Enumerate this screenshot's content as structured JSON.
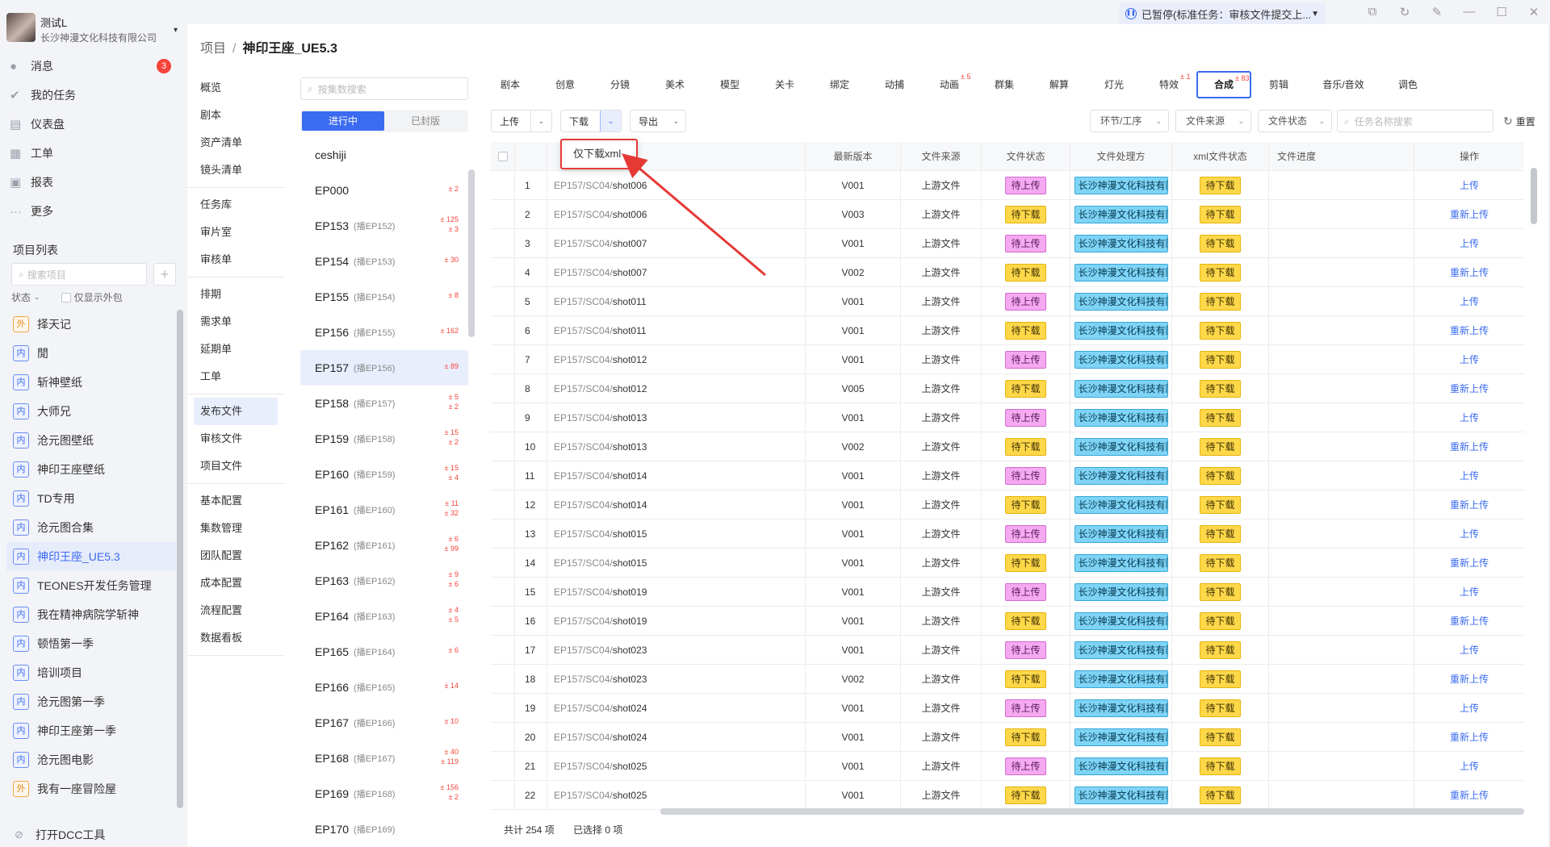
{
  "user": {
    "name": "测试L",
    "company": "长沙神漫文化科技有限公司"
  },
  "nav": [
    {
      "label": "消息",
      "icon": "bell-icon",
      "badge": "3"
    },
    {
      "label": "我的任务",
      "icon": "check-icon"
    },
    {
      "label": "仪表盘",
      "icon": "dashboard-icon"
    },
    {
      "label": "工单",
      "icon": "ticket-icon"
    },
    {
      "label": "报表",
      "icon": "report-icon"
    },
    {
      "label": "更多",
      "icon": "more-icon"
    }
  ],
  "projects": {
    "title": "项目列表",
    "search_placeholder": "搜索项目",
    "status_label": "状态",
    "only_external_label": "仅显示外包",
    "items": [
      {
        "tag": "外",
        "name": "择天记"
      },
      {
        "tag": "内",
        "name": "閒"
      },
      {
        "tag": "内",
        "name": "斩神壁纸"
      },
      {
        "tag": "内",
        "name": "大师兄"
      },
      {
        "tag": "内",
        "name": "沧元图壁纸"
      },
      {
        "tag": "内",
        "name": "神印王座壁纸"
      },
      {
        "tag": "内",
        "name": "TD专用"
      },
      {
        "tag": "内",
        "name": "沧元图合集"
      },
      {
        "tag": "内",
        "name": "神印王座_UE5.3"
      },
      {
        "tag": "内",
        "name": "TEONES开发任务管理"
      },
      {
        "tag": "内",
        "name": "我在精神病院学斩神"
      },
      {
        "tag": "内",
        "name": "顿悟第一季"
      },
      {
        "tag": "内",
        "name": "培训项目"
      },
      {
        "tag": "内",
        "name": "沧元图第一季"
      },
      {
        "tag": "内",
        "name": "神印王座第一季"
      },
      {
        "tag": "内",
        "name": "沧元图电影"
      },
      {
        "tag": "外",
        "name": "我有一座冒险屋"
      }
    ]
  },
  "dcc_label": "打开DCC工具",
  "status_bar": {
    "text": "已暂停(标准任务：审核文件提交上..."
  },
  "breadcrumb": {
    "root": "项目",
    "sep": "/",
    "current": "神印王座_UE5.3"
  },
  "subnav": [
    [
      "概览",
      "剧本",
      "资产清单",
      "镜头清单"
    ],
    [
      "任务库",
      "审片室",
      "审核单"
    ],
    [
      "排期",
      "需求单",
      "延期单",
      "工单"
    ],
    [
      "发布文件",
      "审核文件",
      "项目文件"
    ],
    [
      "基本配置",
      "集数管理",
      "团队配置",
      "成本配置",
      "流程配置",
      "数据看板"
    ]
  ],
  "episodes": {
    "search_placeholder": "按集数搜索",
    "tab_active": "进行中",
    "tab_sealed": "已封版",
    "items": [
      {
        "name": "ceshiji",
        "sub": "",
        "s1": "",
        "s2": ""
      },
      {
        "name": "EP000",
        "sub": "",
        "s1": "± 2",
        "s2": ""
      },
      {
        "name": "EP153",
        "sub": "(播EP152)",
        "s1": "± 125",
        "s2": "± 3"
      },
      {
        "name": "EP154",
        "sub": "(播EP153)",
        "s1": "± 30",
        "s2": ""
      },
      {
        "name": "EP155",
        "sub": "(播EP154)",
        "s1": "± 8",
        "s2": ""
      },
      {
        "name": "EP156",
        "sub": "(播EP155)",
        "s1": "± 162",
        "s2": ""
      },
      {
        "name": "EP157",
        "sub": "(播EP156)",
        "s1": "± 89",
        "s2": ""
      },
      {
        "name": "EP158",
        "sub": "(播EP157)",
        "s1": "± 5",
        "s2": "± 2"
      },
      {
        "name": "EP159",
        "sub": "(播EP158)",
        "s1": "± 15",
        "s2": "± 2"
      },
      {
        "name": "EP160",
        "sub": "(播EP159)",
        "s1": "± 15",
        "s2": "± 4"
      },
      {
        "name": "EP161",
        "sub": "(播EP160)",
        "s1": "± 11",
        "s2": "± 32"
      },
      {
        "name": "EP162",
        "sub": "(播EP161)",
        "s1": "± 6",
        "s2": "± 99"
      },
      {
        "name": "EP163",
        "sub": "(播EP162)",
        "s1": "± 9",
        "s2": "± 6"
      },
      {
        "name": "EP164",
        "sub": "(播EP163)",
        "s1": "± 4",
        "s2": "± 5"
      },
      {
        "name": "EP165",
        "sub": "(播EP164)",
        "s1": "± 6",
        "s2": ""
      },
      {
        "name": "EP166",
        "sub": "(播EP165)",
        "s1": "± 14",
        "s2": ""
      },
      {
        "name": "EP167",
        "sub": "(播EP166)",
        "s1": "± 10",
        "s2": ""
      },
      {
        "name": "EP168",
        "sub": "(播EP167)",
        "s1": "± 40",
        "s2": "± 119"
      },
      {
        "name": "EP169",
        "sub": "(播EP168)",
        "s1": "± 156",
        "s2": "± 2"
      },
      {
        "name": "EP170",
        "sub": "(播EP169)",
        "s1": "",
        "s2": ""
      }
    ]
  },
  "tabs": [
    {
      "label": "剧本",
      "badge": ""
    },
    {
      "label": "创意",
      "badge": ""
    },
    {
      "label": "分镜",
      "badge": ""
    },
    {
      "label": "美术",
      "badge": ""
    },
    {
      "label": "模型",
      "badge": ""
    },
    {
      "label": "关卡",
      "badge": ""
    },
    {
      "label": "绑定",
      "badge": ""
    },
    {
      "label": "动捕",
      "badge": ""
    },
    {
      "label": "动画",
      "badge": "± 5"
    },
    {
      "label": "群集",
      "badge": ""
    },
    {
      "label": "解算",
      "badge": ""
    },
    {
      "label": "灯光",
      "badge": ""
    },
    {
      "label": "特效",
      "badge": "± 1"
    },
    {
      "label": "合成",
      "badge": "± 83"
    },
    {
      "label": "剪辑",
      "badge": ""
    },
    {
      "label": "音乐/音效",
      "badge": ""
    },
    {
      "label": "调色",
      "badge": ""
    }
  ],
  "toolbar": {
    "upload": "上传",
    "download": "下载",
    "export": "导出",
    "filter_stage": "环节/工序",
    "filter_source": "文件来源",
    "filter_status": "文件状态",
    "task_search_placeholder": "任务名称搜索",
    "reset": "重置"
  },
  "dropdown": {
    "item": "仅下载xml"
  },
  "table": {
    "headers": [
      "",
      "",
      "",
      "最新版本",
      "文件来源",
      "文件状态",
      "文件处理方",
      "xml文件状态",
      "文件进度",
      "操作"
    ],
    "shot_prefix": "EP157/SC04/",
    "rows": [
      {
        "n": "1",
        "shot": "shot006",
        "ver": "V001",
        "src": "上游文件",
        "st": "待上传",
        "co": "长沙神漫文化科技有限公司",
        "xml": "待下载",
        "op": "上传"
      },
      {
        "n": "2",
        "shot": "shot006",
        "ver": "V003",
        "src": "上游文件",
        "st": "待下载",
        "co": "长沙神漫文化科技有限公司",
        "xml": "待下载",
        "op": "重新上传"
      },
      {
        "n": "3",
        "shot": "shot007",
        "ver": "V001",
        "src": "上游文件",
        "st": "待上传",
        "co": "长沙神漫文化科技有限公司",
        "xml": "待下载",
        "op": "上传"
      },
      {
        "n": "4",
        "shot": "shot007",
        "ver": "V002",
        "src": "上游文件",
        "st": "待下载",
        "co": "长沙神漫文化科技有限公司",
        "xml": "待下载",
        "op": "重新上传"
      },
      {
        "n": "5",
        "shot": "shot011",
        "ver": "V001",
        "src": "上游文件",
        "st": "待上传",
        "co": "长沙神漫文化科技有限公司",
        "xml": "待下载",
        "op": "上传"
      },
      {
        "n": "6",
        "shot": "shot011",
        "ver": "V001",
        "src": "上游文件",
        "st": "待下载",
        "co": "长沙神漫文化科技有限公司",
        "xml": "待下载",
        "op": "重新上传"
      },
      {
        "n": "7",
        "shot": "shot012",
        "ver": "V001",
        "src": "上游文件",
        "st": "待上传",
        "co": "长沙神漫文化科技有限公司",
        "xml": "待下载",
        "op": "上传"
      },
      {
        "n": "8",
        "shot": "shot012",
        "ver": "V005",
        "src": "上游文件",
        "st": "待下载",
        "co": "长沙神漫文化科技有限公司",
        "xml": "待下载",
        "op": "重新上传"
      },
      {
        "n": "9",
        "shot": "shot013",
        "ver": "V001",
        "src": "上游文件",
        "st": "待上传",
        "co": "长沙神漫文化科技有限公司",
        "xml": "待下载",
        "op": "上传"
      },
      {
        "n": "10",
        "shot": "shot013",
        "ver": "V002",
        "src": "上游文件",
        "st": "待下载",
        "co": "长沙神漫文化科技有限公司",
        "xml": "待下载",
        "op": "重新上传"
      },
      {
        "n": "11",
        "shot": "shot014",
        "ver": "V001",
        "src": "上游文件",
        "st": "待上传",
        "co": "长沙神漫文化科技有限公司",
        "xml": "待下载",
        "op": "上传"
      },
      {
        "n": "12",
        "shot": "shot014",
        "ver": "V001",
        "src": "上游文件",
        "st": "待下载",
        "co": "长沙神漫文化科技有限公司",
        "xml": "待下载",
        "op": "重新上传"
      },
      {
        "n": "13",
        "shot": "shot015",
        "ver": "V001",
        "src": "上游文件",
        "st": "待上传",
        "co": "长沙神漫文化科技有限公司",
        "xml": "待下载",
        "op": "上传"
      },
      {
        "n": "14",
        "shot": "shot015",
        "ver": "V001",
        "src": "上游文件",
        "st": "待下载",
        "co": "长沙神漫文化科技有限公司",
        "xml": "待下载",
        "op": "重新上传"
      },
      {
        "n": "15",
        "shot": "shot019",
        "ver": "V001",
        "src": "上游文件",
        "st": "待上传",
        "co": "长沙神漫文化科技有限公司",
        "xml": "待下载",
        "op": "上传"
      },
      {
        "n": "16",
        "shot": "shot019",
        "ver": "V001",
        "src": "上游文件",
        "st": "待下载",
        "co": "长沙神漫文化科技有限公司",
        "xml": "待下载",
        "op": "重新上传"
      },
      {
        "n": "17",
        "shot": "shot023",
        "ver": "V001",
        "src": "上游文件",
        "st": "待上传",
        "co": "长沙神漫文化科技有限公司",
        "xml": "待下载",
        "op": "上传"
      },
      {
        "n": "18",
        "shot": "shot023",
        "ver": "V002",
        "src": "上游文件",
        "st": "待下载",
        "co": "长沙神漫文化科技有限公司",
        "xml": "待下载",
        "op": "重新上传"
      },
      {
        "n": "19",
        "shot": "shot024",
        "ver": "V001",
        "src": "上游文件",
        "st": "待上传",
        "co": "长沙神漫文化科技有限公司",
        "xml": "待下载",
        "op": "上传"
      },
      {
        "n": "20",
        "shot": "shot024",
        "ver": "V001",
        "src": "上游文件",
        "st": "待下载",
        "co": "长沙神漫文化科技有限公司",
        "xml": "待下载",
        "op": "重新上传"
      },
      {
        "n": "21",
        "shot": "shot025",
        "ver": "V001",
        "src": "上游文件",
        "st": "待上传",
        "co": "长沙神漫文化科技有限公司",
        "xml": "待下载",
        "op": "上传"
      },
      {
        "n": "22",
        "shot": "shot025",
        "ver": "V001",
        "src": "上游文件",
        "st": "待下载",
        "co": "长沙神漫文化科技有限公司",
        "xml": "待下载",
        "op": "重新上传"
      }
    ]
  },
  "footer": {
    "total": "共计 254 项",
    "selected": "已选择 0 项"
  },
  "colors": {
    "accent": "#3b6bf0",
    "upload_pill": "#f4a9f0",
    "download_pill": "#ffd84a",
    "company_pill": "#7fd4f6",
    "annotation": "#e53935"
  }
}
